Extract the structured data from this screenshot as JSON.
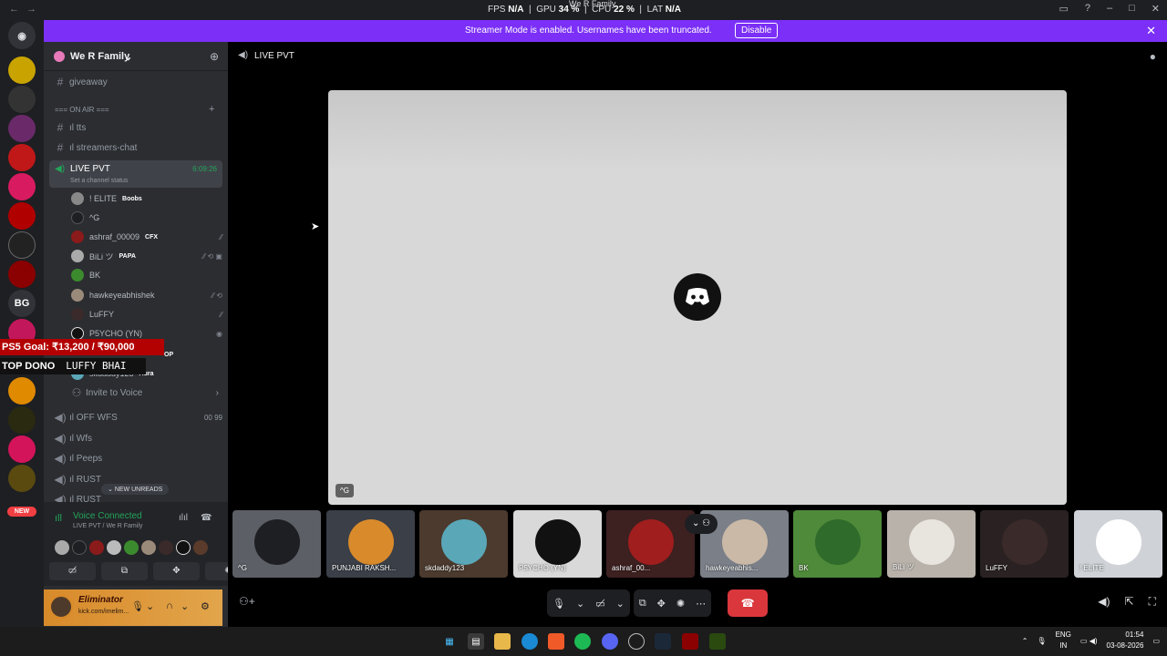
{
  "titlebar": {
    "window_title": "We R Family",
    "fps_label": "FPS",
    "fps": "N/A",
    "gpu_label": "GPU",
    "gpu": "34 %",
    "cpu_label": "CPU",
    "cpu": "22 %",
    "lat_label": "LAT",
    "lat": "N/A"
  },
  "rail": {
    "new_badge": "NEW",
    "bg_server": "BG"
  },
  "banner": {
    "message": "Streamer Mode is enabled. Usernames have been truncated.",
    "disable": "Disable"
  },
  "guild": {
    "name": "We R Family"
  },
  "channels": {
    "giveaway": "giveaway",
    "category": "=== ON AIR ===",
    "tts": "ıl tts",
    "streamers_chat": "ıl streamers-chat",
    "live": {
      "name": "LIVE PVT",
      "status": "Set a channel status",
      "timer": "6:09:26"
    },
    "members": [
      {
        "name": "! ELITE",
        "tag": "Boobs"
      },
      {
        "name": "^G",
        "tag": ""
      },
      {
        "name": "ashraf_00009",
        "tag": "CFX"
      },
      {
        "name": "BiLi ツ",
        "tag": "PAPA"
      },
      {
        "name": "BK",
        "tag": ""
      },
      {
        "name": "hawkeyeabhishek",
        "tag": ""
      },
      {
        "name": "LuFFY",
        "tag": ""
      },
      {
        "name": "P5YCHO (YN)",
        "tag": ""
      },
      {
        "name": "skdaddy123",
        "tag": "Aura"
      }
    ],
    "invite_to_voice": "Invite to Voice",
    "off_wfs": "ıl OFF WFS",
    "off_wfs_count_a": "00",
    "off_wfs_count_b": "99",
    "wfs": "ıl Wfs",
    "peeps": "ıl Peeps",
    "rust": "ıl RUST",
    "rust2": "ıl RUST",
    "new_unreads": "NEW UNREADS"
  },
  "overlay": {
    "goal": "PS5 Goal: ₹13,200 / ₹90,000",
    "dono_label": "TOP DONO",
    "dono_name": "LUFFY BHAI",
    "op": "OP"
  },
  "voice": {
    "title": "Voice Connected",
    "subtitle": "LIVE PVT / We R Family"
  },
  "user": {
    "name": "Eliminator",
    "status": "kick.com/imelim..."
  },
  "main": {
    "channel_title": "LIVE PVT",
    "stage_name": "^G",
    "tiles": [
      {
        "label": "^G",
        "bg": "#5c5f66",
        "face": "#1e1f22"
      },
      {
        "label": "PUNJABI RAKSH...",
        "bg": "#3a3f48",
        "face": "#d98a2b"
      },
      {
        "label": "skdaddy123",
        "bg": "#4b3a2d",
        "face": "#5aa7b8"
      },
      {
        "label": "P5YCHO (YN)",
        "bg": "#d9d9d9",
        "face": "#111111"
      },
      {
        "label": "ashraf_00...",
        "bg": "#3d2020",
        "face": "#a01e1e"
      },
      {
        "label": "hawkeyeabhis...",
        "bg": "#7a7f88",
        "face": "#c9b9a6"
      },
      {
        "label": "BK",
        "bg": "#4f8a3a",
        "face": "#2f6b2a"
      },
      {
        "label": "BiLi ツ",
        "bg": "#b8b2aa",
        "face": "#e8e4de"
      },
      {
        "label": "LuFFY",
        "bg": "#2a2222",
        "face": "#3b2a2a"
      },
      {
        "label": "! ELITE",
        "bg": "#cfd3d8",
        "face": "#ffffff"
      }
    ]
  },
  "taskbar": {
    "lang1": "ENG",
    "lang2": "IN",
    "time": "01:54",
    "date": "03-08-2026"
  },
  "colors": {
    "accent": "#7b2ff7",
    "live_green": "#23a55a",
    "end_call": "#da373c"
  }
}
